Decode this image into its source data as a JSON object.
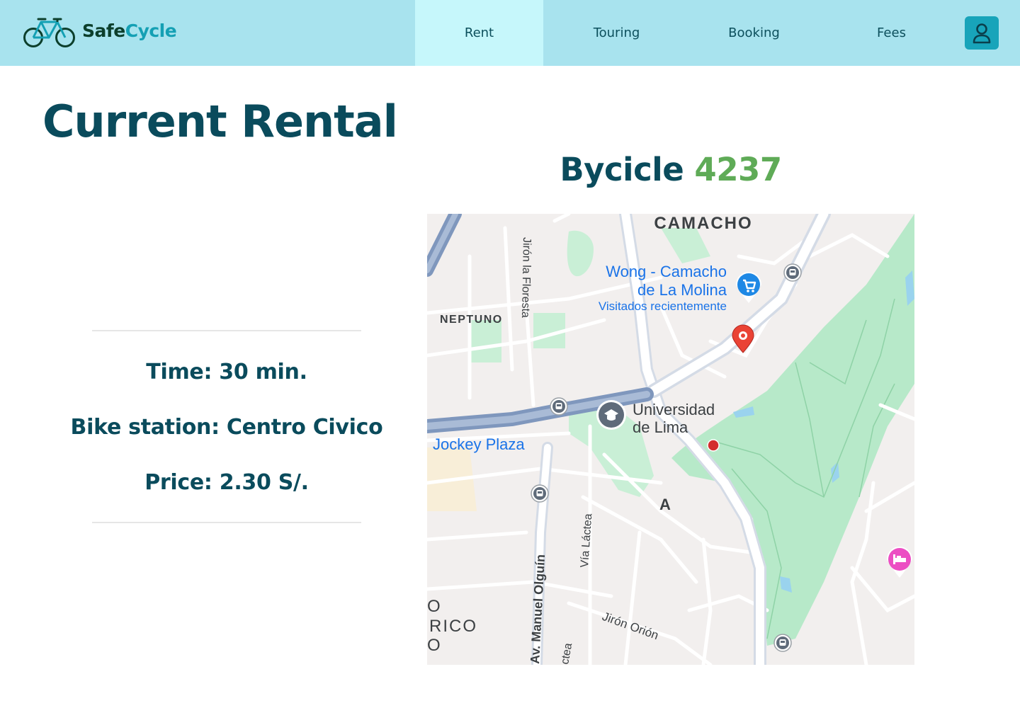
{
  "app": {
    "brand_part1": "Safe",
    "brand_part2": "Cycle",
    "brand_color_dark": "#0c3f2c",
    "brand_color_accent": "#14a0b4"
  },
  "nav": {
    "items": [
      {
        "label": "Rent",
        "active": true
      },
      {
        "label": "Touring",
        "active": false
      },
      {
        "label": "Booking",
        "active": false
      },
      {
        "label": "Fees",
        "active": false
      }
    ],
    "user_icon": "user-icon"
  },
  "page": {
    "title": "Current Rental",
    "bike_label": "Bycicle",
    "bike_number": "4237"
  },
  "rental": {
    "time": "Time: 30 min.",
    "station": "Bike station: Centro Civico",
    "price": "Price: 2.30 S/."
  },
  "map": {
    "labels": {
      "camacho": "CAMACHO",
      "neptuno": "NEPTUNO",
      "floresta": "Jirón la Floresta",
      "wong1": "Wong - Camacho",
      "wong2": "de La Molina",
      "visitados": "Visitados recientemente",
      "univ1": "Universidad",
      "univ2": "de Lima",
      "jockey": "Jockey Plaza",
      "letter_a": "A",
      "lactea": "Vía Láctea",
      "lactea2": "ctea",
      "olguin": "Av. Manuel Olguín",
      "orion": "Jirón Orión",
      "cut1": "O",
      "cut2": "RICO",
      "cut3": "O"
    },
    "pins": [
      "shopping-cart-icon",
      "location-pin-icon",
      "education-icon",
      "hotel-icon",
      "bus-stop-icon"
    ],
    "colors": {
      "park": "#b7e9c9",
      "road": "#ffffff",
      "highway": "#8fa5c6",
      "label_blue": "#1a73e8",
      "pin_red": "#ea4335",
      "hotel_pink": "#ec4ec3"
    }
  }
}
